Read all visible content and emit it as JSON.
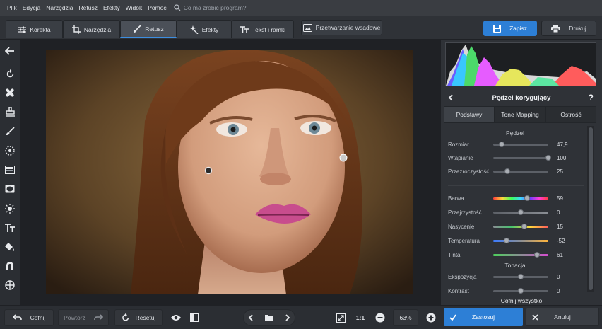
{
  "menu": [
    "Plik",
    "Edycja",
    "Narzędzia",
    "Retusz",
    "Efekty",
    "Widok",
    "Pomoc"
  ],
  "search": {
    "placeholder": "Co ma zrobić program?"
  },
  "tabs": [
    {
      "label": "Korekta",
      "icon": "sliders-icon"
    },
    {
      "label": "Narzędzia",
      "icon": "crop-icon"
    },
    {
      "label": "Retusz",
      "icon": "brush-icon",
      "active": true
    },
    {
      "label": "Efekty",
      "icon": "sparkle-icon"
    },
    {
      "label": "Tekst i ramki",
      "icon": "text-icon"
    }
  ],
  "batch": {
    "label": "Przetwarzanie wsadowe"
  },
  "save": {
    "label": "Zapisz"
  },
  "print": {
    "label": "Drukuj"
  },
  "panel": {
    "title": "Pędzel korygujący",
    "help": "?",
    "tabs": [
      "Podstawy",
      "Tone Mapping",
      "Ostrość"
    ],
    "brush_section": "Pędzel",
    "brush": [
      {
        "label": "Rozmiar",
        "value": "47,9",
        "pos": 0.16
      },
      {
        "label": "Wtapianie",
        "value": "100",
        "pos": 1.0
      },
      {
        "label": "Przezroczystość",
        "value": "25",
        "pos": 0.25
      }
    ],
    "color": [
      {
        "label": "Barwa",
        "value": "59",
        "pos": 0.62
      },
      {
        "label": "Przejrzystość",
        "value": "0",
        "pos": 0.5
      },
      {
        "label": "Nasycenie",
        "value": "15",
        "pos": 0.57
      },
      {
        "label": "Temperatura",
        "value": "-52",
        "pos": 0.24
      },
      {
        "label": "Tinta",
        "value": "61",
        "pos": 0.8
      }
    ],
    "tone_section": "Tonacja",
    "tone": [
      {
        "label": "Ekspozycja",
        "value": "0",
        "pos": 0.5
      },
      {
        "label": "Kontrast",
        "value": "0",
        "pos": 0.5
      }
    ],
    "reset_all": "Cofnij wszystko"
  },
  "bottom": {
    "undo": "Cofnij",
    "redo": "Powtórz",
    "reset": "Resetuj",
    "zoom_one": "1:1",
    "zoom_level": "63%",
    "apply": "Zastosuj",
    "cancel": "Anuluj"
  },
  "colors": {
    "accent": "#2d7fd6",
    "panel": "#2f3237",
    "canvas": "#1f2125"
  }
}
